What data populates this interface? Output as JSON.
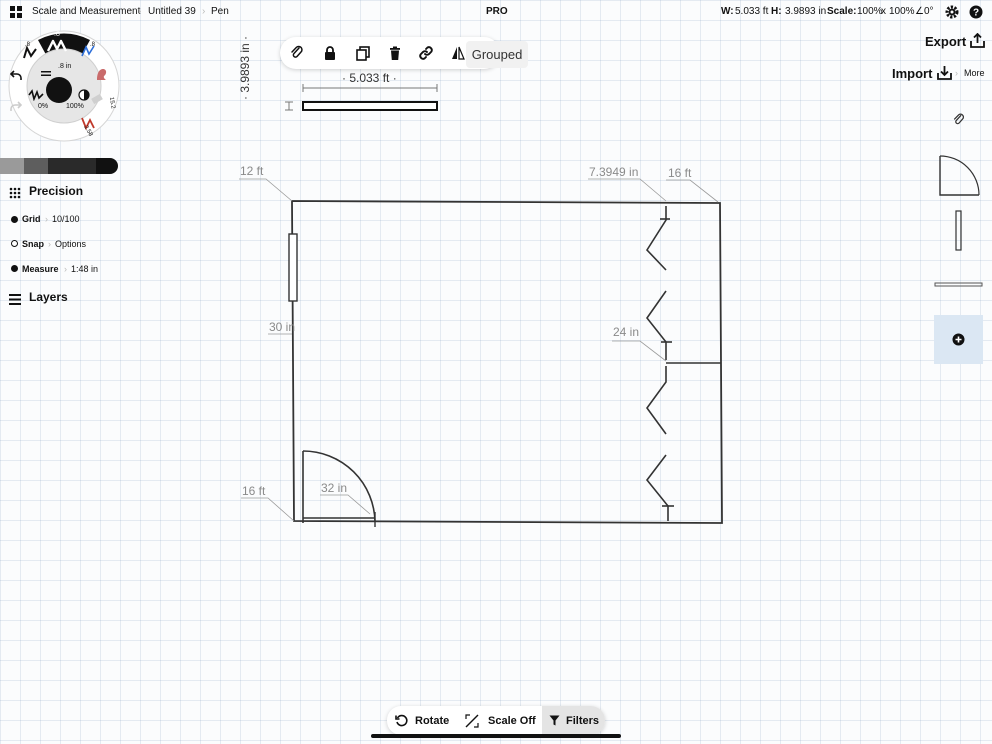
{
  "topbar": {
    "breadcrumb": [
      "Scale and Measurement",
      "Untitled 39",
      "Pen"
    ],
    "badge": "PRO",
    "w_label": "W:",
    "w_value": "5.033 ft",
    "h_label": "H:",
    "h_value": "3.9893 in",
    "scale_label": "Scale:",
    "scale_x": "100%",
    "scale_times": "x",
    "scale_y": "100%",
    "angle": "∠0°"
  },
  "toolbar": {
    "icons": [
      "paperclip-icon",
      "lock-icon",
      "duplicate-icon",
      "trash-icon",
      "link-icon",
      "flip-icon"
    ],
    "grouped_label": "Grouped"
  },
  "brush_wheel": {
    "size_value": ".8",
    "size_in": ".8 in",
    "opacity_left": "0%",
    "opacity_right": "100%",
    "ring_values": [
      ".8",
      ".8",
      "15.2",
      "2.58"
    ],
    "colors": {
      "active": "#111111",
      "accent_red": "#c0392b",
      "accent_blue": "#2e6fd9"
    }
  },
  "swatches": [
    "#9a9a9a",
    "#5e5e5e",
    "#2a2a2a",
    "#111111"
  ],
  "precision": {
    "title": "Precision",
    "items": [
      {
        "label": "Grid",
        "value": "10/100",
        "on": true
      },
      {
        "label": "Snap",
        "value": "Options",
        "on": false
      },
      {
        "label": "Measure",
        "value": "1:48 in",
        "on": true
      }
    ],
    "layers_label": "Layers"
  },
  "right": {
    "export_label": "Export",
    "import_label": "Import",
    "more_label": "More",
    "library_items": [
      "paperclip-icon",
      "door-swing-shape",
      "window-vertical-shape",
      "wall-segment-shape",
      "add-icon"
    ],
    "add_bg": "#dbe7f3"
  },
  "canvas": {
    "selection_width_label": "· 5.033 ft ·",
    "selection_height_label": "· 3.9893 in ·",
    "dims": [
      "12 ft",
      "7.3949 in",
      "16 ft",
      "30 in",
      "24 in",
      "16 ft",
      "32 in"
    ]
  },
  "bottombar": {
    "rotate_label": "Rotate",
    "scale_label": "Scale Off",
    "filters_label": "Filters"
  }
}
